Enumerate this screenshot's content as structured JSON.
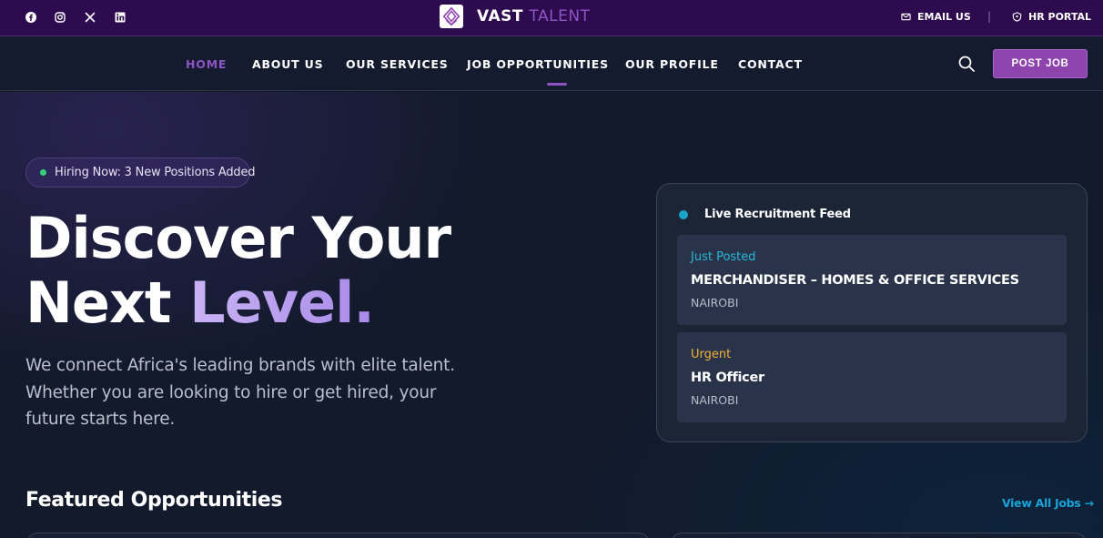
{
  "topbar": {
    "social": [
      "facebook-icon",
      "instagram-icon",
      "x-icon",
      "linkedin-icon"
    ],
    "brand": {
      "first": "VAST",
      "second": "TALENT"
    },
    "email_label": "EMAIL US",
    "divider": "|",
    "portal_label": "HR PORTAL"
  },
  "nav": {
    "items": [
      {
        "label": "HOME",
        "active": true
      },
      {
        "label": "ABOUT US"
      },
      {
        "label": "OUR SERVICES"
      },
      {
        "label": "JOB OPPORTUNITIES"
      },
      {
        "label": "OUR PROFILE"
      },
      {
        "label": "CONTACT"
      }
    ],
    "post_job_label": "POST JOB"
  },
  "hero": {
    "badge": "Hiring Now: 3 New Positions Added",
    "headline_line1": "Discover Your",
    "headline_line2_plain": "Next ",
    "headline_line2_accent": "Level.",
    "subtext": "We connect Africa's leading brands with elite talent. Whether you are looking to hire or get hired, your future starts here."
  },
  "feed": {
    "title": "Live Recruitment Feed",
    "jobs": [
      {
        "tag": "Just Posted",
        "tag_color": "#27b8d8",
        "title": "MERCHANDISER – HOMES & OFFICE SERVICES",
        "location": "NAIROBI"
      },
      {
        "tag": "Urgent",
        "tag_color": "#f2b233",
        "title": "HR Officer",
        "location": "NAIROBI"
      }
    ]
  },
  "featured": {
    "title": "Featured Opportunities",
    "view_all": "View All Jobs →"
  },
  "colors": {
    "brand_purple": "#8e44ad",
    "topbar": "#2e0b4f",
    "accent_cyan": "#1aa3d6"
  }
}
